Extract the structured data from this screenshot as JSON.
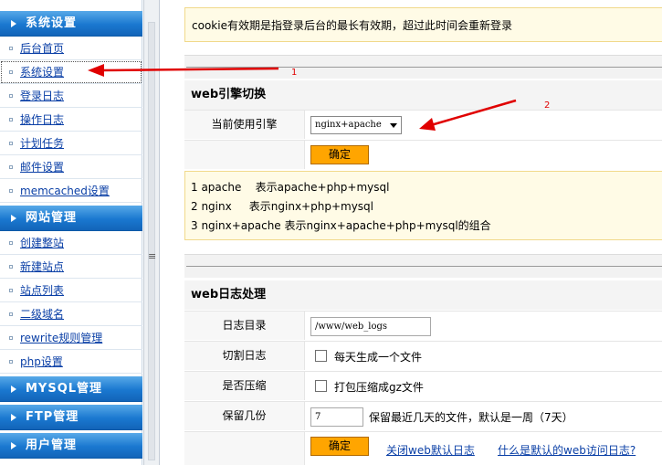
{
  "sidebar": {
    "sections": [
      {
        "title": "系统设置",
        "items": [
          "后台首页",
          "系统设置",
          "登录日志",
          "操作日志",
          "计划任务",
          "邮件设置",
          "memcached设置"
        ]
      },
      {
        "title": "网站管理",
        "items": [
          "创建整站",
          "新建站点",
          "站点列表",
          "二级域名",
          "rewrite规则管理",
          "php设置"
        ]
      },
      {
        "title": "MYSQL管理",
        "items": []
      },
      {
        "title": "FTP管理",
        "items": []
      },
      {
        "title": "用户管理",
        "items": []
      }
    ],
    "active_item": "系统设置"
  },
  "main": {
    "notice": "cookie有效期是指登录后台的最长有效期，超过此时间会重新登录",
    "engine": {
      "title": "web引擎切换",
      "label": "当前使用引擎",
      "selected": "nginx+apache",
      "confirm": "确定",
      "info": [
        "1 apache    表示apache+php+mysql",
        "2 nginx     表示nginx+php+mysql",
        "3 nginx+apache 表示nginx+apache+php+mysql的组合"
      ]
    },
    "log": {
      "title": "web日志处理",
      "dir_label": "日志目录",
      "dir_value": "/www/web_logs",
      "cut_label": "切割日志",
      "cut_text": "每天生成一个文件",
      "compress_label": "是否压缩",
      "compress_text": "打包压缩成gz文件",
      "keep_label": "保留几份",
      "keep_value": "7",
      "keep_hint": "保留最近几天的文件，默认是一周（7天）",
      "confirm": "确定",
      "link1": "关闭web默认日志",
      "link2": "什么是默认的web访问日志?"
    }
  },
  "annotations": {
    "arrow1": "1",
    "arrow2": "2"
  },
  "colors": {
    "sidebar_header": "#1a78d0",
    "button": "#ffa500",
    "link": "#0a3fa6",
    "notice_bg": "#fffbe6",
    "annotation": "#e00000"
  }
}
